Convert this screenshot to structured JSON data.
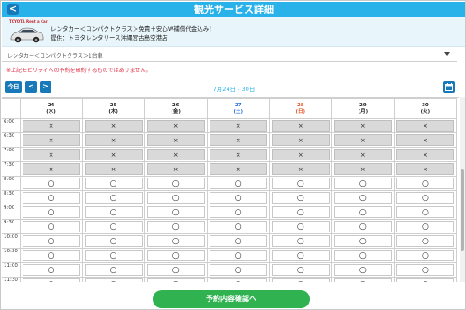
{
  "header": {
    "back_label": "<",
    "title": "観光サービス詳細"
  },
  "info": {
    "logo_text": "TOYOTA Rent a Car",
    "line1": "レンタカー＜コンパクトクラス＞免責＋安心W補償代金込み！",
    "line2": "提供：トヨタレンタリース沖縄宮古島空港店"
  },
  "select": {
    "value": "レンタカー＜コンパクトクラス＞1台車"
  },
  "notice": "※上記モビリティへの予約を確約するものではありません。",
  "toolbar": {
    "today_label": "今日",
    "prev_label": "<",
    "next_label": ">",
    "range": "7月24日 - 30日"
  },
  "days": [
    {
      "date": "24",
      "dow": "(水)",
      "type": "weekday"
    },
    {
      "date": "25",
      "dow": "(木)",
      "type": "weekday"
    },
    {
      "date": "26",
      "dow": "(金)",
      "type": "weekday"
    },
    {
      "date": "27",
      "dow": "(土)",
      "type": "sat"
    },
    {
      "date": "28",
      "dow": "(日)",
      "type": "sun"
    },
    {
      "date": "29",
      "dow": "(月)",
      "type": "weekday"
    },
    {
      "date": "30",
      "dow": "(火)",
      "type": "weekday"
    }
  ],
  "slots": [
    {
      "time": "6:00",
      "status": "×"
    },
    {
      "time": "6:30",
      "status": "×"
    },
    {
      "time": "7:00",
      "status": "×"
    },
    {
      "time": "7:30",
      "status": "×"
    },
    {
      "time": "8:00",
      "status": "○"
    },
    {
      "time": "8:30",
      "status": "○"
    },
    {
      "time": "9:00",
      "status": "○"
    },
    {
      "time": "9:30",
      "status": "○"
    },
    {
      "time": "10:00",
      "status": "○"
    },
    {
      "time": "10:30",
      "status": "○"
    },
    {
      "time": "11:00",
      "status": "○"
    },
    {
      "time": "11:30",
      "status": "○"
    }
  ],
  "confirm_label": "予約内容確認へ",
  "icons": {
    "calendar": "calendar-icon",
    "back": "chevron-left-icon",
    "car": "car-image"
  },
  "colors": {
    "header": "#29b2e9",
    "button": "#1779b8",
    "confirm": "#2fb24f",
    "notice": "#e0344a"
  }
}
